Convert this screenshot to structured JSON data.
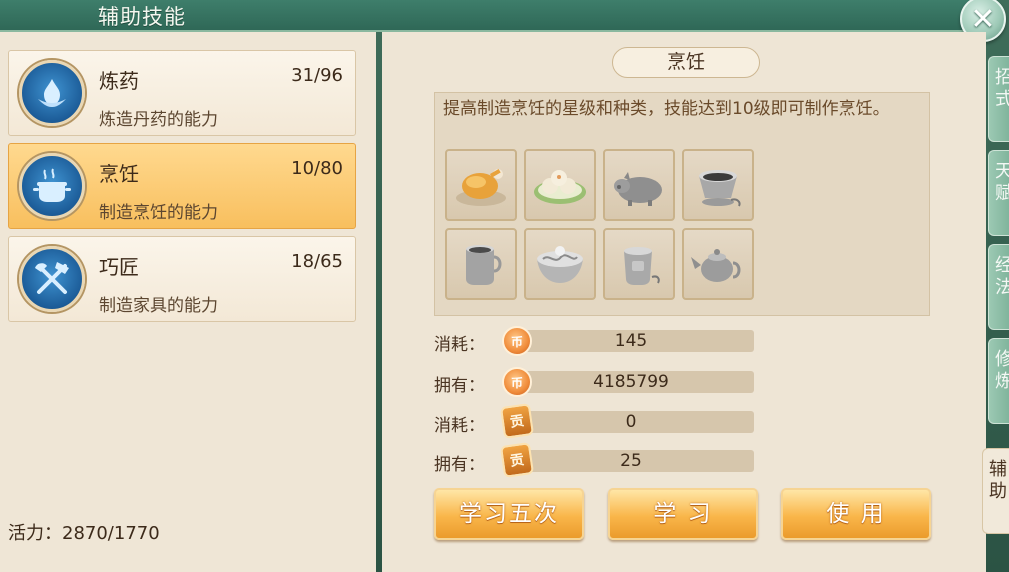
{
  "window": {
    "title": "辅助技能"
  },
  "skills": [
    {
      "name": "炼药",
      "desc": "炼造丹药的能力",
      "count": "31/96",
      "icon": "lotus-flame-icon"
    },
    {
      "name": "烹饪",
      "desc": "制造烹饪的能力",
      "count": "10/80",
      "icon": "cooking-pot-icon"
    },
    {
      "name": "巧匠",
      "desc": "制造家具的能力",
      "count": "18/65",
      "icon": "hammer-axe-icon"
    }
  ],
  "vitality": "活力：2870/1770",
  "detail": {
    "title": "烹饪",
    "description": "提高制造烹饪的星级和种类，技能达到10级即可制作烹饪。",
    "items": [
      "roast-chicken-icon",
      "buns-plate-icon",
      "roast-pig-icon",
      "tea-cup-icon",
      "tea-mug-icon",
      "noodle-bowl-icon",
      "tea-cup-2-icon",
      "teapot-icon"
    ]
  },
  "resources": [
    {
      "label": "消耗：",
      "value": "145",
      "icon": "coin-icon"
    },
    {
      "label": "拥有：",
      "value": "4185799",
      "icon": "coin-icon"
    },
    {
      "label": "消耗：",
      "value": "0",
      "icon": "merit-badge-icon"
    },
    {
      "label": "拥有：",
      "value": "25",
      "icon": "merit-badge-icon"
    }
  ],
  "buttons": {
    "learn_five": "学习五次",
    "learn": "学 习",
    "use": "使 用"
  },
  "side_tabs": [
    "招式",
    "天赋",
    "经法",
    "修炼",
    "辅助"
  ],
  "colors": {
    "selected_card": "#f8bf5e",
    "button": "#f9b64a",
    "accent_green": "#3e7e6b"
  }
}
